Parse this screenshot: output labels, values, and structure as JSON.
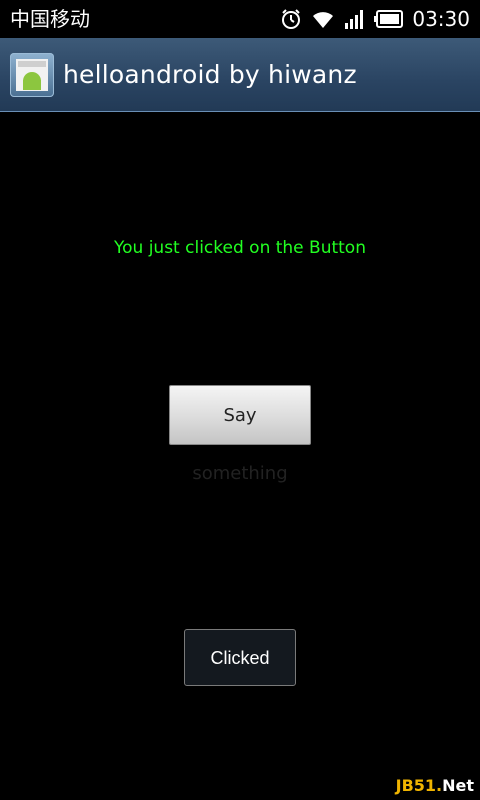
{
  "status_bar": {
    "carrier": "中国移动",
    "time": "03:30",
    "icons": [
      "alarm-icon",
      "wifi-icon",
      "signal-icon",
      "battery-icon"
    ]
  },
  "title_bar": {
    "app_icon": "android-app-icon",
    "title": "helloandroid by hiwanz"
  },
  "main": {
    "message": "You just clicked on the Button",
    "message_color": "#22ff22",
    "say_button_label": "Say something",
    "clicked_button_label": "Clicked"
  },
  "watermark": {
    "part1": "JB51",
    "part2": ".",
    "part3": "Net"
  }
}
